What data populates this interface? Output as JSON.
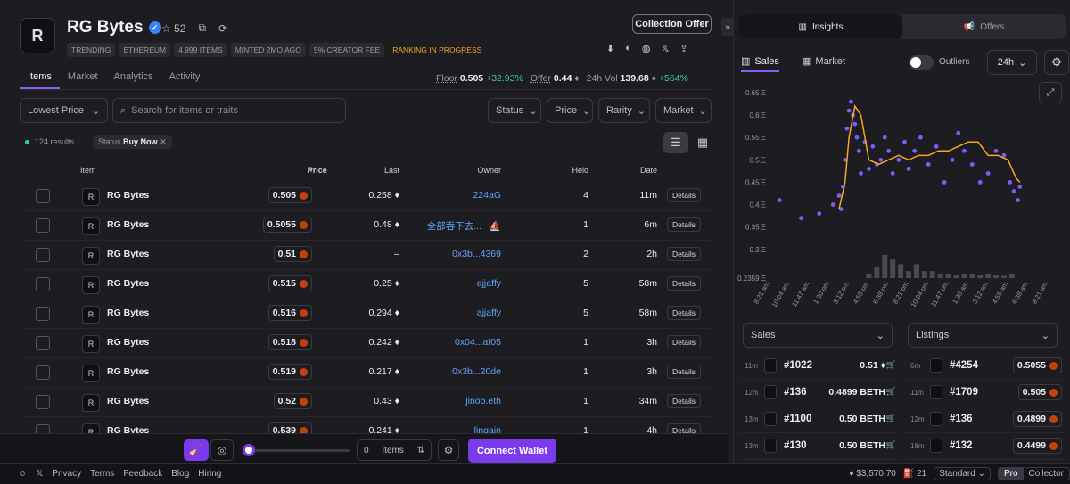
{
  "collection": {
    "name": "RG Bytes",
    "logo_letter": "R",
    "stars": "52",
    "tags": [
      "TRENDING",
      "ETHEREUM",
      "4,999 ITEMS",
      "MINTED 2MO AGO",
      "5% CREATOR FEE"
    ],
    "ranking": "RANKING IN PROGRESS",
    "offer_button": "Collection Offer"
  },
  "tabs": [
    "Items",
    "Market",
    "Analytics",
    "Activity"
  ],
  "stats": {
    "floor_label": "Floor",
    "floor": "0.505",
    "floor_change": "+32.93%",
    "offer_label": "Offer",
    "offer": "0.44",
    "vol_label": "24h Vol",
    "vol": "139.68",
    "vol_change": "+564%"
  },
  "filters": {
    "sort": "Lowest Price",
    "search_placeholder": "Search for items or traits",
    "status": "Status",
    "price": "Price",
    "rarity": "Rarity",
    "market": "Market"
  },
  "results": "124 results",
  "chip": {
    "label": "Status",
    "value": "Buy Now"
  },
  "table": {
    "headers": {
      "item": "Item",
      "price": "Price",
      "last": "Last",
      "owner": "Owner",
      "held": "Held",
      "date": "Date"
    },
    "details_label": "Details",
    "rows": [
      {
        "name": "RG Bytes",
        "price": "0.505",
        "last": "0.258",
        "owner": "224aG",
        "held": "4",
        "date": "11m"
      },
      {
        "name": "RG Bytes",
        "price": "0.5055",
        "last": "0.48",
        "owner": "全部吞下去...",
        "held": "1",
        "date": "6m"
      },
      {
        "name": "RG Bytes",
        "price": "0.51",
        "last": "–",
        "owner": "0x3b...4369",
        "held": "2",
        "date": "2h"
      },
      {
        "name": "RG Bytes",
        "price": "0.515",
        "last": "0.25",
        "owner": "ajjaffy",
        "held": "5",
        "date": "58m"
      },
      {
        "name": "RG Bytes",
        "price": "0.516",
        "last": "0.294",
        "owner": "ajjaffy",
        "held": "5",
        "date": "58m"
      },
      {
        "name": "RG Bytes",
        "price": "0.518",
        "last": "0.242",
        "owner": "0x04...af05",
        "held": "1",
        "date": "3h"
      },
      {
        "name": "RG Bytes",
        "price": "0.519",
        "last": "0.217",
        "owner": "0x3b...20de",
        "held": "1",
        "date": "3h"
      },
      {
        "name": "RG Bytes",
        "price": "0.52",
        "last": "0.43",
        "owner": "jinoo.eth",
        "held": "1",
        "date": "34m"
      },
      {
        "name": "RG Bytes",
        "price": "0.539",
        "last": "0.241",
        "owner": "lingain",
        "held": "1",
        "date": "4h"
      }
    ]
  },
  "bottom": {
    "qty": "0",
    "qty_label": "Items",
    "connect": "Connect Wallet"
  },
  "footer": {
    "links": [
      "Privacy",
      "Terms",
      "Feedback",
      "Blog",
      "Hiring"
    ],
    "eth_price": "$3,570.70",
    "gas": "21",
    "mode": "Standard",
    "pro": "Pro",
    "collector": "Collector"
  },
  "right": {
    "tab_insights": "Insights",
    "tab_offers": "Offers",
    "sales_tab": "Sales",
    "market_tab": "Market",
    "outliers": "Outliers",
    "period": "24h",
    "sales_dd": "Sales",
    "listings_dd": "Listings",
    "sales": [
      {
        "t": "11m",
        "id": "#1022",
        "price": "0.51"
      },
      {
        "t": "12m",
        "id": "#136",
        "price": "0.4899 BETH"
      },
      {
        "t": "13m",
        "id": "#1100",
        "price": "0.50 BETH"
      },
      {
        "t": "13m",
        "id": "#130",
        "price": "0.50 BETH"
      }
    ],
    "listings": [
      {
        "t": "6m",
        "id": "#4254",
        "price": "0.5055"
      },
      {
        "t": "11m",
        "id": "#1709",
        "price": "0.505"
      },
      {
        "t": "12m",
        "id": "#136",
        "price": "0.4899"
      },
      {
        "t": "18m",
        "id": "#132",
        "price": "0.4499"
      }
    ]
  },
  "chart_data": {
    "type": "scatter",
    "y_ticks": [
      "0.65 Ξ",
      "0.6 Ξ",
      "0.55 Ξ",
      "0.5 Ξ",
      "0.45 Ξ",
      "0.4 Ξ",
      "0.35 Ξ",
      "0.3 Ξ",
      "0.2359 Ξ"
    ],
    "ylim": [
      0.2359,
      0.65
    ],
    "x_ticks": [
      "8:21 am",
      "10:04 am",
      "11:47 am",
      "1:30 pm",
      "3:12 pm",
      "4:55 pm",
      "6:38 pm",
      "8:21 pm",
      "10:04 pm",
      "11:47 pm",
      "1:30 am",
      "3:12 am",
      "4:55 am",
      "6:38 am",
      "8:21 am"
    ],
    "colors": {
      "points": "#7c5cf6",
      "line": "#f5a623",
      "volume": "#4a4a52"
    },
    "line": [
      [
        3.5,
        0.39
      ],
      [
        3.8,
        0.45
      ],
      [
        4.0,
        0.55
      ],
      [
        4.3,
        0.62
      ],
      [
        4.6,
        0.6
      ],
      [
        5.0,
        0.5
      ],
      [
        5.5,
        0.49
      ],
      [
        6,
        0.5
      ],
      [
        6.5,
        0.51
      ],
      [
        7,
        0.5
      ],
      [
        7.5,
        0.51
      ],
      [
        8,
        0.51
      ],
      [
        8.5,
        0.52
      ],
      [
        9,
        0.52
      ],
      [
        9.5,
        0.53
      ],
      [
        10,
        0.54
      ],
      [
        10.5,
        0.54
      ],
      [
        11,
        0.51
      ],
      [
        11.5,
        0.51
      ],
      [
        12,
        0.5
      ],
      [
        12.4,
        0.46
      ],
      [
        12.6,
        0.45
      ]
    ],
    "points": [
      [
        0.5,
        0.41
      ],
      [
        1.6,
        0.37
      ],
      [
        2.5,
        0.38
      ],
      [
        3.2,
        0.4
      ],
      [
        3.5,
        0.42
      ],
      [
        3.6,
        0.39
      ],
      [
        3.7,
        0.44
      ],
      [
        3.8,
        0.5
      ],
      [
        3.9,
        0.57
      ],
      [
        4.0,
        0.61
      ],
      [
        4.1,
        0.63
      ],
      [
        4.2,
        0.6
      ],
      [
        4.3,
        0.58
      ],
      [
        4.4,
        0.55
      ],
      [
        4.5,
        0.52
      ],
      [
        4.6,
        0.47
      ],
      [
        4.8,
        0.54
      ],
      [
        5,
        0.48
      ],
      [
        5.2,
        0.53
      ],
      [
        5.4,
        0.49
      ],
      [
        5.6,
        0.5
      ],
      [
        5.8,
        0.55
      ],
      [
        6,
        0.52
      ],
      [
        6.2,
        0.47
      ],
      [
        6.5,
        0.5
      ],
      [
        6.8,
        0.54
      ],
      [
        7,
        0.48
      ],
      [
        7.3,
        0.52
      ],
      [
        7.6,
        0.55
      ],
      [
        8,
        0.49
      ],
      [
        8.4,
        0.53
      ],
      [
        8.8,
        0.45
      ],
      [
        9.2,
        0.5
      ],
      [
        9.5,
        0.56
      ],
      [
        9.8,
        0.52
      ],
      [
        10.2,
        0.49
      ],
      [
        10.6,
        0.45
      ],
      [
        11,
        0.47
      ],
      [
        11.4,
        0.52
      ],
      [
        11.8,
        0.51
      ],
      [
        12.1,
        0.45
      ],
      [
        12.3,
        0.43
      ],
      [
        12.5,
        0.41
      ],
      [
        12.6,
        0.44
      ]
    ],
    "volume": [
      [
        5.0,
        0.2
      ],
      [
        5.4,
        0.5
      ],
      [
        5.8,
        1.0
      ],
      [
        6.2,
        0.8
      ],
      [
        6.6,
        0.6
      ],
      [
        7.0,
        0.3
      ],
      [
        7.4,
        0.6
      ],
      [
        7.8,
        0.3
      ],
      [
        8.2,
        0.3
      ],
      [
        8.6,
        0.2
      ],
      [
        9.0,
        0.2
      ],
      [
        9.4,
        0.15
      ],
      [
        9.8,
        0.2
      ],
      [
        10.2,
        0.2
      ],
      [
        10.6,
        0.15
      ],
      [
        11.0,
        0.2
      ],
      [
        11.4,
        0.15
      ],
      [
        11.8,
        0.1
      ],
      [
        12.2,
        0.2
      ]
    ]
  }
}
